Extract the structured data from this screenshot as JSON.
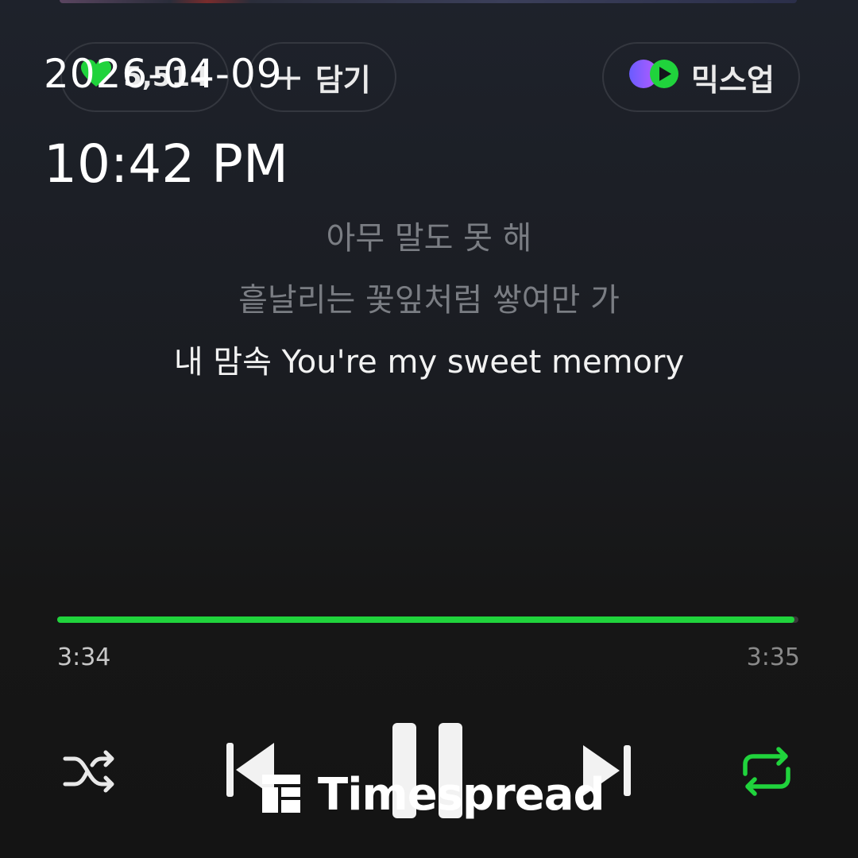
{
  "header": {
    "like_count": "5,514",
    "add_label": "담기",
    "add_symbol": "+",
    "mixup_label": "믹스업"
  },
  "overlay": {
    "date": "2026-04-09",
    "time": "10:42 PM"
  },
  "lyrics": [
    {
      "text": "아무 말도 못 해",
      "state": "past"
    },
    {
      "text": "흩날리는 꽃잎처럼 쌓여만 가",
      "state": "past"
    },
    {
      "text": "내 맘속 You're my sweet memory",
      "state": "current"
    }
  ],
  "player": {
    "current_time": "3:34",
    "total_time": "3:35",
    "progress": 0.995,
    "accent_color": "#20d33c"
  },
  "controls": {
    "shuffle_icon": "shuffle-icon",
    "prev_icon": "skip-previous-icon",
    "pause_icon": "pause-icon",
    "next_icon": "skip-next-icon",
    "repeat_icon": "repeat-icon",
    "repeat_active": true
  },
  "watermark": {
    "text": "Timespread"
  }
}
